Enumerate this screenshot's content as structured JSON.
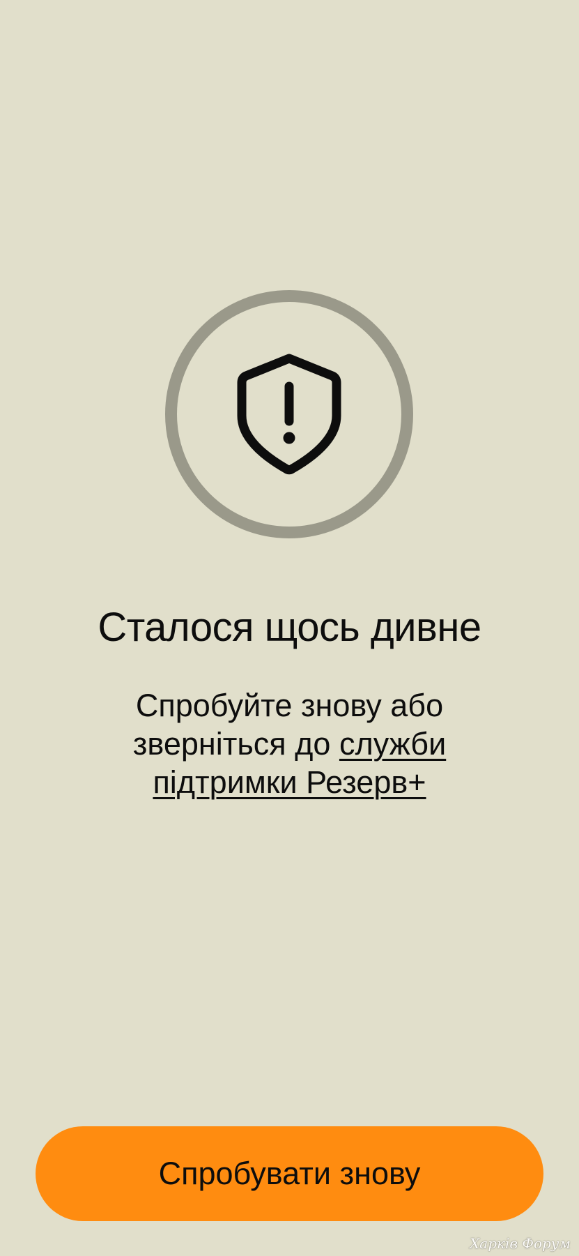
{
  "error_screen": {
    "icon": "shield-alert-icon",
    "title": "Сталося щось дивне",
    "message_line_1": "Спробуйте знову або",
    "message_line_2_prefix": "зверніться до ",
    "support_link_part_1": "служби",
    "support_link_part_2": "підтримки Резерв+",
    "retry_button_label": "Спробувати знову"
  },
  "watermark": {
    "text": "Харків Форум"
  },
  "colors": {
    "background": "#e1dfcb",
    "ring": "#9a998a",
    "accent_button": "#ff8c10",
    "text": "#0d0d0d"
  }
}
